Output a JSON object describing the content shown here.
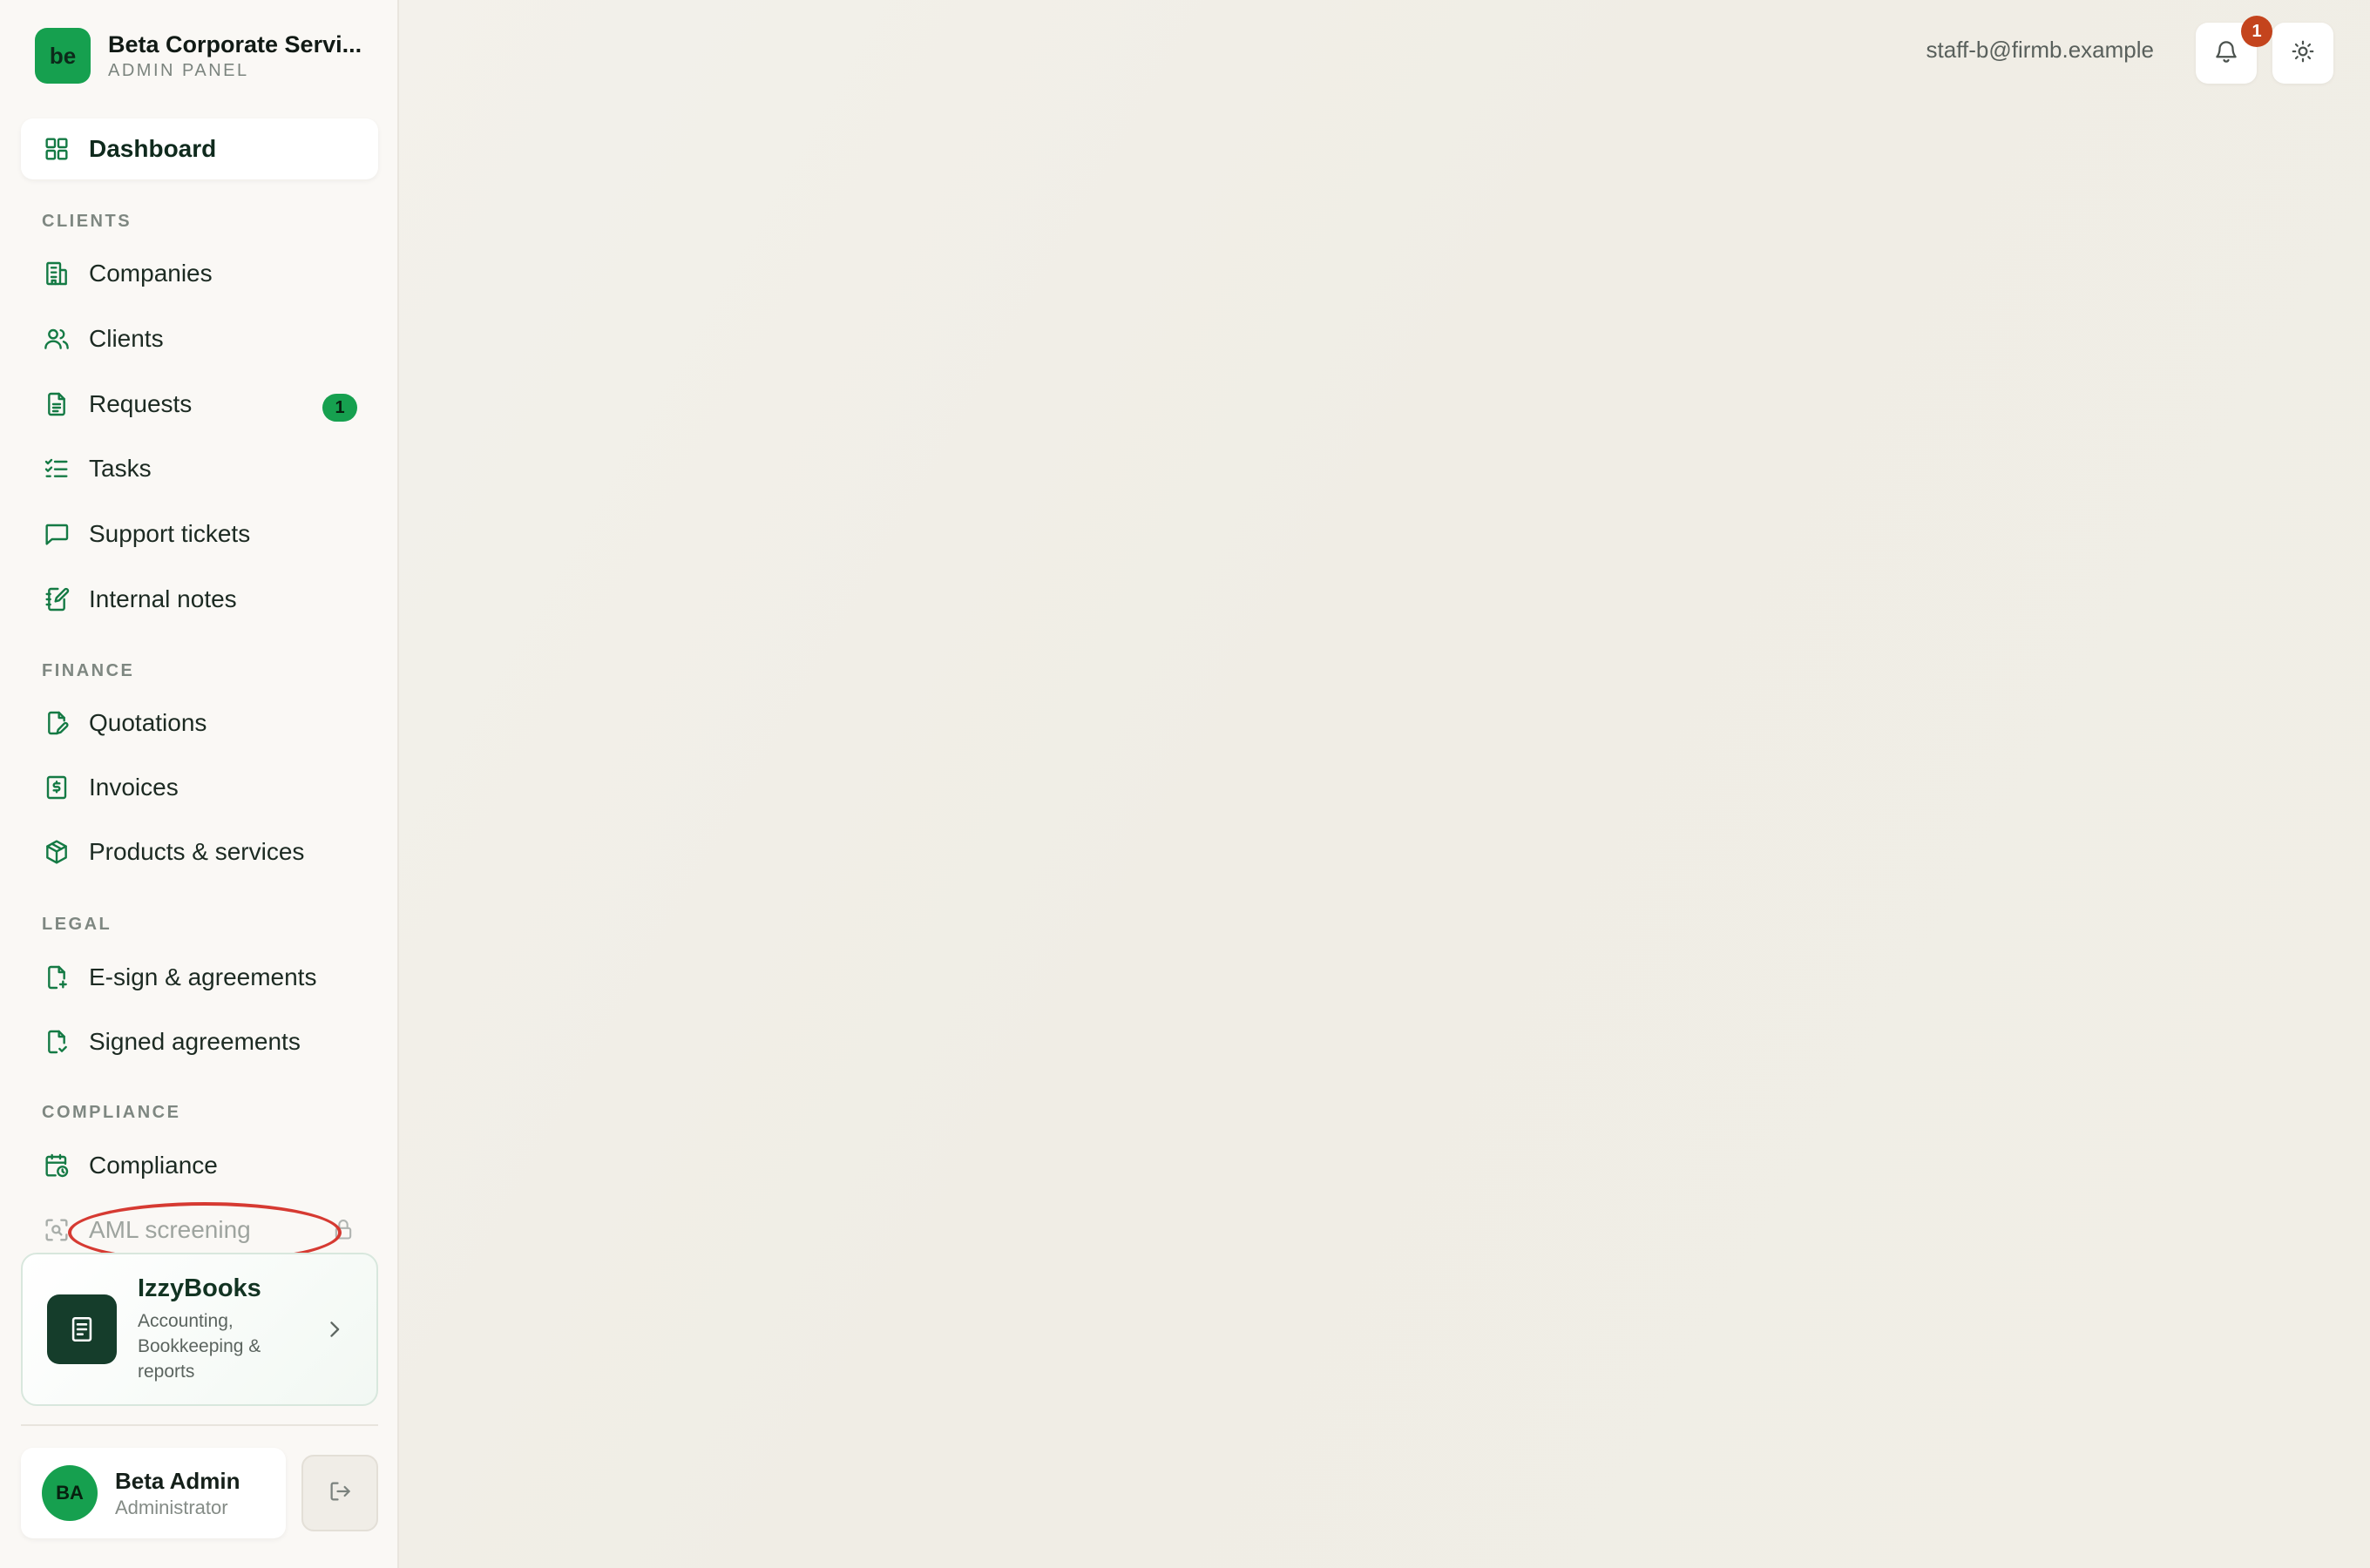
{
  "brand": {
    "logo_text": "be",
    "name": "Beta Corporate Servi...",
    "subtitle": "ADMIN PANEL"
  },
  "nav": {
    "dashboard": "Dashboard",
    "sections": {
      "clients": "CLIENTS",
      "finance": "FINANCE",
      "legal": "LEGAL",
      "compliance": "COMPLIANCE"
    },
    "companies": "Companies",
    "clients": "Clients",
    "requests": "Requests",
    "requests_badge": "1",
    "tasks": "Tasks",
    "support_tickets": "Support tickets",
    "internal_notes": "Internal notes",
    "quotations": "Quotations",
    "invoices": "Invoices",
    "products_services": "Products & services",
    "esign": "E-sign & agreements",
    "signed_agreements": "Signed agreements",
    "compliance": "Compliance",
    "aml_screening": "AML screening"
  },
  "promo": {
    "title": "IzzyBooks",
    "description": "Accounting, Bookkeeping & reports"
  },
  "user": {
    "initials": "BA",
    "name": "Beta Admin",
    "role": "Administrator"
  },
  "header": {
    "email": "staff-b@firmb.example",
    "notification_count": "1"
  },
  "colors": {
    "accent": "#16a04f",
    "icon_green": "#147a44",
    "highlight_ring": "#d63a32",
    "notification_badge": "#c4441d"
  }
}
